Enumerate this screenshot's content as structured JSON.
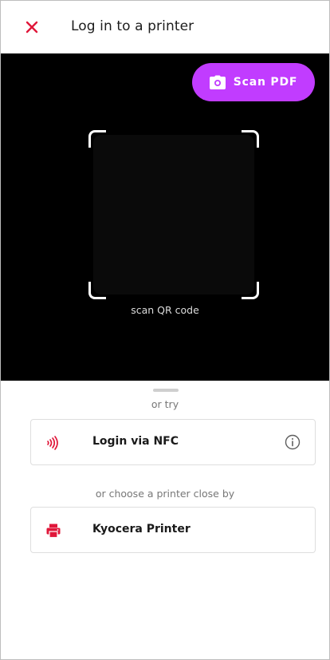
{
  "header": {
    "title": "Log in to a printer",
    "close_icon": "close-icon"
  },
  "camera": {
    "scan_pdf_label": "Scan PDF",
    "scan_pdf_icon": "camera-icon",
    "qr_caption": "scan QR code"
  },
  "sheet": {
    "or_try": "or try",
    "nfc": {
      "label": "Login via NFC",
      "icon": "nfc-icon",
      "info_icon": "info-icon"
    },
    "choose_text": "or choose a printer close by",
    "printer": {
      "label": "Kyocera Printer",
      "icon": "printer-icon"
    }
  },
  "colors": {
    "accent_red": "#e0173a",
    "scan_button": "#c13cff",
    "camera_bg": "#000000"
  }
}
